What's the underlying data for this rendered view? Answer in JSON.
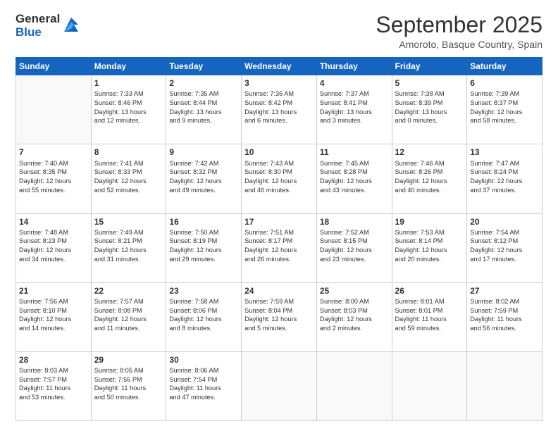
{
  "logo": {
    "general": "General",
    "blue": "Blue"
  },
  "title": "September 2025",
  "location": "Amoroto, Basque Country, Spain",
  "weekdays": [
    "Sunday",
    "Monday",
    "Tuesday",
    "Wednesday",
    "Thursday",
    "Friday",
    "Saturday"
  ],
  "weeks": [
    [
      {
        "day": "",
        "info": ""
      },
      {
        "day": "1",
        "info": "Sunrise: 7:33 AM\nSunset: 8:46 PM\nDaylight: 13 hours\nand 12 minutes."
      },
      {
        "day": "2",
        "info": "Sunrise: 7:35 AM\nSunset: 8:44 PM\nDaylight: 13 hours\nand 9 minutes."
      },
      {
        "day": "3",
        "info": "Sunrise: 7:36 AM\nSunset: 8:42 PM\nDaylight: 13 hours\nand 6 minutes."
      },
      {
        "day": "4",
        "info": "Sunrise: 7:37 AM\nSunset: 8:41 PM\nDaylight: 13 hours\nand 3 minutes."
      },
      {
        "day": "5",
        "info": "Sunrise: 7:38 AM\nSunset: 8:39 PM\nDaylight: 13 hours\nand 0 minutes."
      },
      {
        "day": "6",
        "info": "Sunrise: 7:39 AM\nSunset: 8:37 PM\nDaylight: 12 hours\nand 58 minutes."
      }
    ],
    [
      {
        "day": "7",
        "info": "Sunrise: 7:40 AM\nSunset: 8:35 PM\nDaylight: 12 hours\nand 55 minutes."
      },
      {
        "day": "8",
        "info": "Sunrise: 7:41 AM\nSunset: 8:33 PM\nDaylight: 12 hours\nand 52 minutes."
      },
      {
        "day": "9",
        "info": "Sunrise: 7:42 AM\nSunset: 8:32 PM\nDaylight: 12 hours\nand 49 minutes."
      },
      {
        "day": "10",
        "info": "Sunrise: 7:43 AM\nSunset: 8:30 PM\nDaylight: 12 hours\nand 46 minutes."
      },
      {
        "day": "11",
        "info": "Sunrise: 7:45 AM\nSunset: 8:28 PM\nDaylight: 12 hours\nand 43 minutes."
      },
      {
        "day": "12",
        "info": "Sunrise: 7:46 AM\nSunset: 8:26 PM\nDaylight: 12 hours\nand 40 minutes."
      },
      {
        "day": "13",
        "info": "Sunrise: 7:47 AM\nSunset: 8:24 PM\nDaylight: 12 hours\nand 37 minutes."
      }
    ],
    [
      {
        "day": "14",
        "info": "Sunrise: 7:48 AM\nSunset: 8:23 PM\nDaylight: 12 hours\nand 34 minutes."
      },
      {
        "day": "15",
        "info": "Sunrise: 7:49 AM\nSunset: 8:21 PM\nDaylight: 12 hours\nand 31 minutes."
      },
      {
        "day": "16",
        "info": "Sunrise: 7:50 AM\nSunset: 8:19 PM\nDaylight: 12 hours\nand 29 minutes."
      },
      {
        "day": "17",
        "info": "Sunrise: 7:51 AM\nSunset: 8:17 PM\nDaylight: 12 hours\nand 26 minutes."
      },
      {
        "day": "18",
        "info": "Sunrise: 7:52 AM\nSunset: 8:15 PM\nDaylight: 12 hours\nand 23 minutes."
      },
      {
        "day": "19",
        "info": "Sunrise: 7:53 AM\nSunset: 8:14 PM\nDaylight: 12 hours\nand 20 minutes."
      },
      {
        "day": "20",
        "info": "Sunrise: 7:54 AM\nSunset: 8:12 PM\nDaylight: 12 hours\nand 17 minutes."
      }
    ],
    [
      {
        "day": "21",
        "info": "Sunrise: 7:56 AM\nSunset: 8:10 PM\nDaylight: 12 hours\nand 14 minutes."
      },
      {
        "day": "22",
        "info": "Sunrise: 7:57 AM\nSunset: 8:08 PM\nDaylight: 12 hours\nand 11 minutes."
      },
      {
        "day": "23",
        "info": "Sunrise: 7:58 AM\nSunset: 8:06 PM\nDaylight: 12 hours\nand 8 minutes."
      },
      {
        "day": "24",
        "info": "Sunrise: 7:59 AM\nSunset: 8:04 PM\nDaylight: 12 hours\nand 5 minutes."
      },
      {
        "day": "25",
        "info": "Sunrise: 8:00 AM\nSunset: 8:03 PM\nDaylight: 12 hours\nand 2 minutes."
      },
      {
        "day": "26",
        "info": "Sunrise: 8:01 AM\nSunset: 8:01 PM\nDaylight: 11 hours\nand 59 minutes."
      },
      {
        "day": "27",
        "info": "Sunrise: 8:02 AM\nSunset: 7:59 PM\nDaylight: 11 hours\nand 56 minutes."
      }
    ],
    [
      {
        "day": "28",
        "info": "Sunrise: 8:03 AM\nSunset: 7:57 PM\nDaylight: 11 hours\nand 53 minutes."
      },
      {
        "day": "29",
        "info": "Sunrise: 8:05 AM\nSunset: 7:55 PM\nDaylight: 11 hours\nand 50 minutes."
      },
      {
        "day": "30",
        "info": "Sunrise: 8:06 AM\nSunset: 7:54 PM\nDaylight: 11 hours\nand 47 minutes."
      },
      {
        "day": "",
        "info": ""
      },
      {
        "day": "",
        "info": ""
      },
      {
        "day": "",
        "info": ""
      },
      {
        "day": "",
        "info": ""
      }
    ]
  ]
}
